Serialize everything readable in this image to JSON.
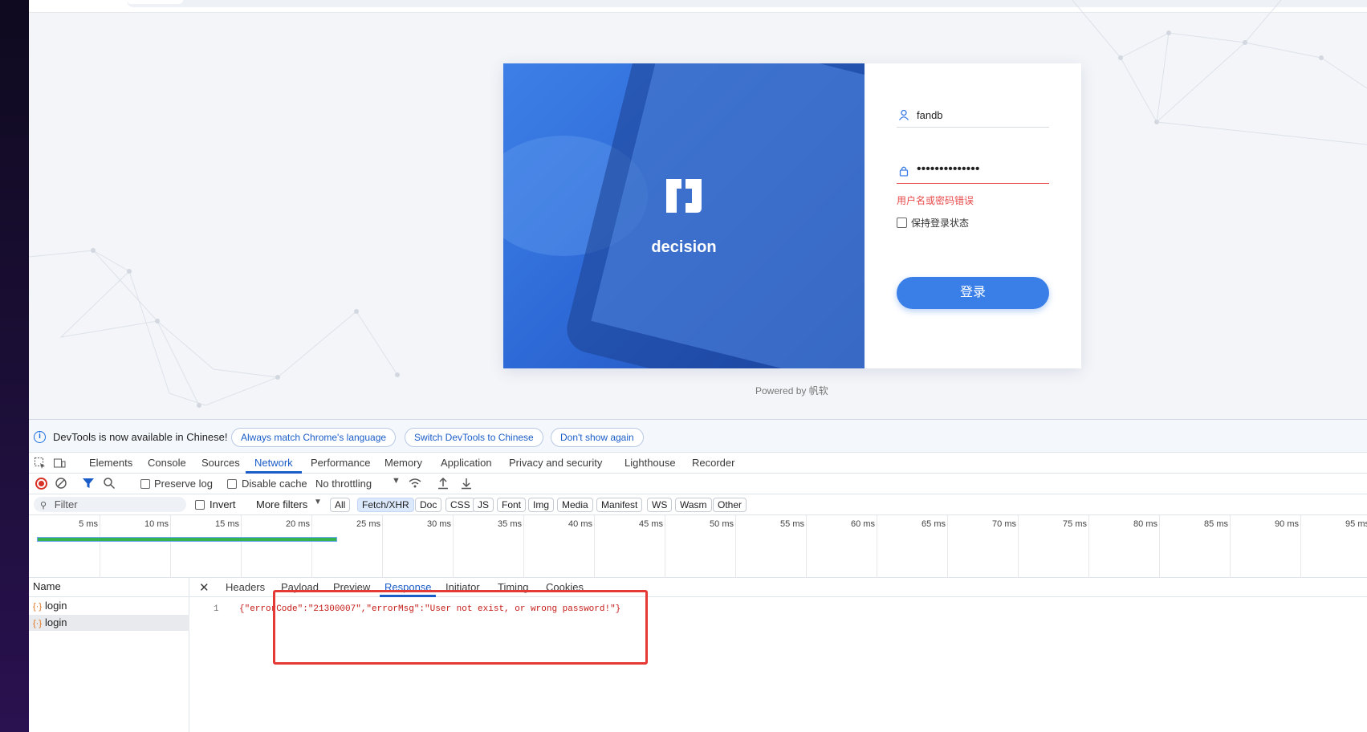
{
  "login": {
    "brand": "decision",
    "username": "fandb",
    "password_mask": "••••••••••••••",
    "error": "用户名或密码错误",
    "remember_label": "保持登录状态",
    "login_button": "登录",
    "powered_by": "Powered by 帆软"
  },
  "devtools": {
    "info_message": "DevTools is now available in Chinese!",
    "info_buttons": [
      "Always match Chrome's language",
      "Switch DevTools to Chinese",
      "Don't show again"
    ],
    "tabs": [
      "Elements",
      "Console",
      "Sources",
      "Network",
      "Performance",
      "Memory",
      "Application",
      "Privacy and security",
      "Lighthouse",
      "Recorder"
    ],
    "active_tab": "Network",
    "toolbar": {
      "preserve_log": "Preserve log",
      "disable_cache": "Disable cache",
      "throttling": "No throttling"
    },
    "filter": {
      "placeholder": "Filter",
      "invert": "Invert",
      "more_filters": "More filters",
      "chips": [
        "All",
        "Fetch/XHR",
        "Doc",
        "CSS",
        "JS",
        "Font",
        "Img",
        "Media",
        "Manifest",
        "WS",
        "Wasm",
        "Other"
      ],
      "selected_chip": "Fetch/XHR"
    },
    "timeline_ticks": [
      "5 ms",
      "10 ms",
      "15 ms",
      "20 ms",
      "25 ms",
      "30 ms",
      "35 ms",
      "40 ms",
      "45 ms",
      "50 ms",
      "55 ms",
      "60 ms",
      "65 ms",
      "70 ms",
      "75 ms",
      "80 ms",
      "85 ms",
      "90 ms",
      "95 ms"
    ],
    "name_header": "Name",
    "requests": [
      "login",
      "login"
    ],
    "detail_tabs": [
      "Headers",
      "Payload",
      "Preview",
      "Response",
      "Initiator",
      "Timing",
      "Cookies"
    ],
    "active_detail_tab": "Response",
    "response_line_number": "1",
    "response_body": "{\"errorCode\":\"21300007\",\"errorMsg\":\"User not exist, or wrong password!\"}"
  },
  "colors": {
    "accent": "#3a7fe8",
    "error": "#e84a4a",
    "devtools_active": "#1a5dc8",
    "highlight_box": "#e53935"
  }
}
